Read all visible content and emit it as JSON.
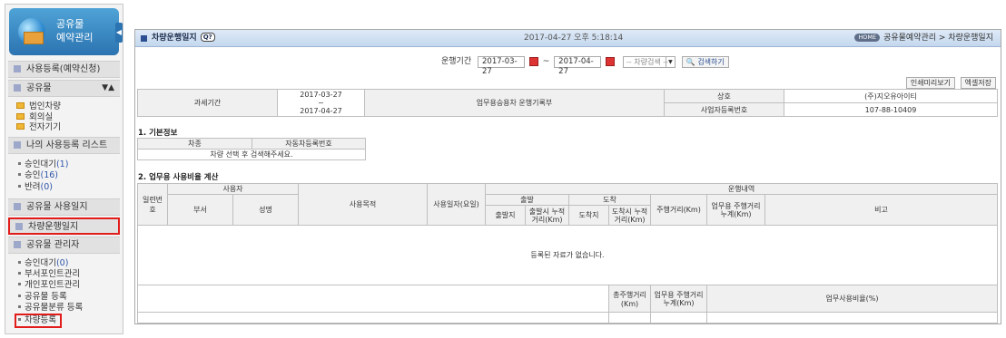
{
  "sidebar": {
    "logo_line1": "공유물",
    "logo_line2": "예약관리",
    "toggle_glyph": "◀",
    "sections": {
      "reg": "사용등록(예약신청)",
      "shared": "공유물",
      "shared_arrows": "▼▲",
      "folders": [
        "법인차량",
        "회의실",
        "전자기기"
      ],
      "my_list": "나의 사용등록 리스트",
      "my_items": [
        {
          "label": "승인대기",
          "count": "(1)"
        },
        {
          "label": "승인",
          "count": "(16)"
        },
        {
          "label": "반려",
          "count": "(0)"
        }
      ],
      "usage_log": "공유물 사용일지",
      "vehicle_log": "차량운행일지",
      "admin": "공유물 관리자",
      "admin_items": [
        {
          "label": "승인대기",
          "count": "(0)"
        },
        {
          "label": "부서포인트관리",
          "count": ""
        },
        {
          "label": "개인포인트관리",
          "count": ""
        },
        {
          "label": "공유물 등록",
          "count": ""
        },
        {
          "label": "공유물분류 등록",
          "count": ""
        },
        {
          "label": "차량등록",
          "count": ""
        }
      ]
    }
  },
  "titlebar": {
    "title": "차량운행일지",
    "badge": "Q?",
    "datetime": "2017-04-27 오후 5:18:14",
    "home_pill": "HOME",
    "breadcrumb": "공유물예약관리 > 차량운행일지"
  },
  "search": {
    "label": "운행기간",
    "from": "2017-03-27",
    "sep": "~",
    "to": "2017-04-27",
    "select": "-- 차량검색 --",
    "button": "검색하기"
  },
  "actions": {
    "print": "인쇄미리보기",
    "excel": "엑셀저장"
  },
  "summary": {
    "period_label": "과세기간",
    "period_from": "2017-03-27",
    "period_tilde": "~",
    "period_to": "2017-04-27",
    "form_label": "업무용승용차 운행기록부",
    "company_label": "상호",
    "company_value": "(주)지오유아이티",
    "bizno_label": "사업자등록번호",
    "bizno_value": "107-88-10409"
  },
  "basic": {
    "title": "1. 기본정보",
    "col_type": "차종",
    "col_plate": "자동차등록번호",
    "empty": "차량 선택 후 검색해주세요."
  },
  "ratio": {
    "title": "2. 업무용 사용비율 계산",
    "col_no": "일련번호",
    "col_user": "사용자",
    "col_dept": "부서",
    "col_name": "성명",
    "col_purpose": "사용목적",
    "col_date": "사용일자(요일)",
    "col_run": "운행내역",
    "col_depart": "출발",
    "col_arrive": "도착",
    "col_depart_place": "출발지",
    "col_depart_km": "출발시 누적거리(Km)",
    "col_arrive_place": "도착지",
    "col_arrive_km": "도착시 누적거리(Km)",
    "col_distance": "주행거리(Km)",
    "col_biz_dist": "업무용 주행거리 누계(Km)",
    "col_note": "비고",
    "empty": "등록된 자료가 없습니다.",
    "total_dist": "총주행거리(Km)",
    "total_biz": "업무용 주행거리 누계(Km)",
    "biz_ratio": "업무사용비율(%)"
  }
}
